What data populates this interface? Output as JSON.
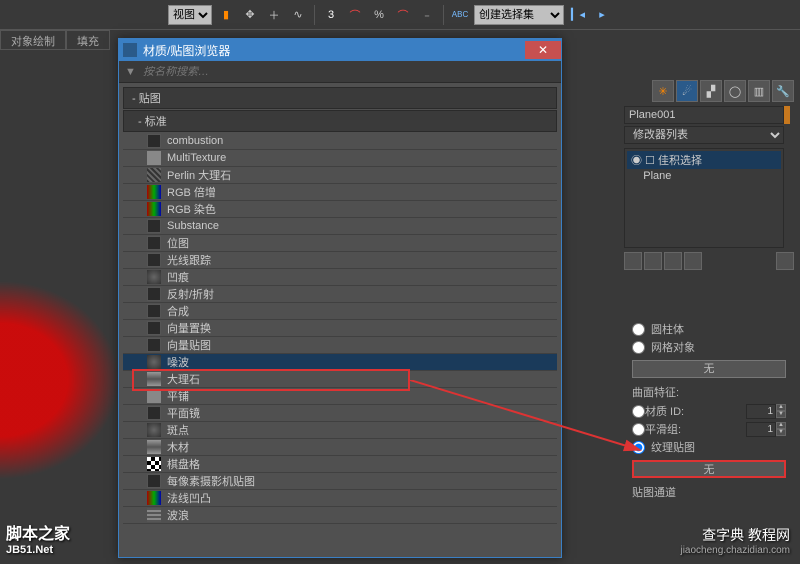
{
  "toolbar": {
    "viewport_label": "视图",
    "selection_set_label": "创建选择集",
    "icons": [
      "bookmark",
      "move",
      "plus",
      "link",
      "three",
      "arc-a",
      "percent",
      "arc-b",
      "sub",
      "abc",
      "prev",
      "next"
    ]
  },
  "tabs": {
    "item0": "对象绘制",
    "item1": "填充"
  },
  "dialog": {
    "title": "材质/贴图浏览器",
    "search_placeholder": "按名称搜索…",
    "tree_head": "- 贴图",
    "std_head": "- 标准",
    "items": [
      {
        "label": "combustion",
        "icon": "ic-dk"
      },
      {
        "label": "MultiTexture",
        "icon": "ic-lt"
      },
      {
        "label": "Perlin 大理石",
        "icon": "ic-perlin"
      },
      {
        "label": "RGB 倍增",
        "icon": "ic-rgb"
      },
      {
        "label": "RGB 染色",
        "icon": "ic-rgb"
      },
      {
        "label": "Substance",
        "icon": "ic-dk"
      },
      {
        "label": "位图",
        "icon": "ic-dk"
      },
      {
        "label": "光线跟踪",
        "icon": "ic-dk"
      },
      {
        "label": "凹痕",
        "icon": "ic-noise"
      },
      {
        "label": "反射/折射",
        "icon": "ic-dk"
      },
      {
        "label": "合成",
        "icon": "ic-dk"
      },
      {
        "label": "向量置换",
        "icon": "ic-dk"
      },
      {
        "label": "向量贴图",
        "icon": "ic-dk"
      },
      {
        "label": "噪波",
        "icon": "ic-noise",
        "sel": true
      },
      {
        "label": "大理石",
        "icon": "ic-marb"
      },
      {
        "label": "平铺",
        "icon": "ic-lt"
      },
      {
        "label": "平面镜",
        "icon": "ic-dk"
      },
      {
        "label": "斑点",
        "icon": "ic-noise"
      },
      {
        "label": "木材",
        "icon": "ic-marb"
      },
      {
        "label": "棋盘格",
        "icon": "ic-ch"
      },
      {
        "label": "每像素摄影机贴图",
        "icon": "ic-dk"
      },
      {
        "label": "法线凹凸",
        "icon": "ic-rgb"
      },
      {
        "label": "波浪",
        "icon": "ic-wave"
      }
    ]
  },
  "right": {
    "object_name": "Plane001",
    "modifier_list_label": "修改器列表",
    "stack": {
      "item0": "佳积选择",
      "item1": "Plane"
    }
  },
  "params": {
    "cyl": "圆柱体",
    "mesh": "网格对象",
    "none1": "无",
    "curve_header": "曲面特征:",
    "mat_id": "材质 ID:",
    "mat_id_val": "1",
    "smooth": "平滑组:",
    "smooth_val": "1",
    "texmap": "纹理贴图",
    "none2": "无",
    "channel_header": "贴图通道"
  },
  "watermarks": {
    "left_name": "脚本之家",
    "left_url": "JB51.Net",
    "right_name": "查字典 教程网",
    "right_url": "jiaocheng.chazidian.com"
  }
}
